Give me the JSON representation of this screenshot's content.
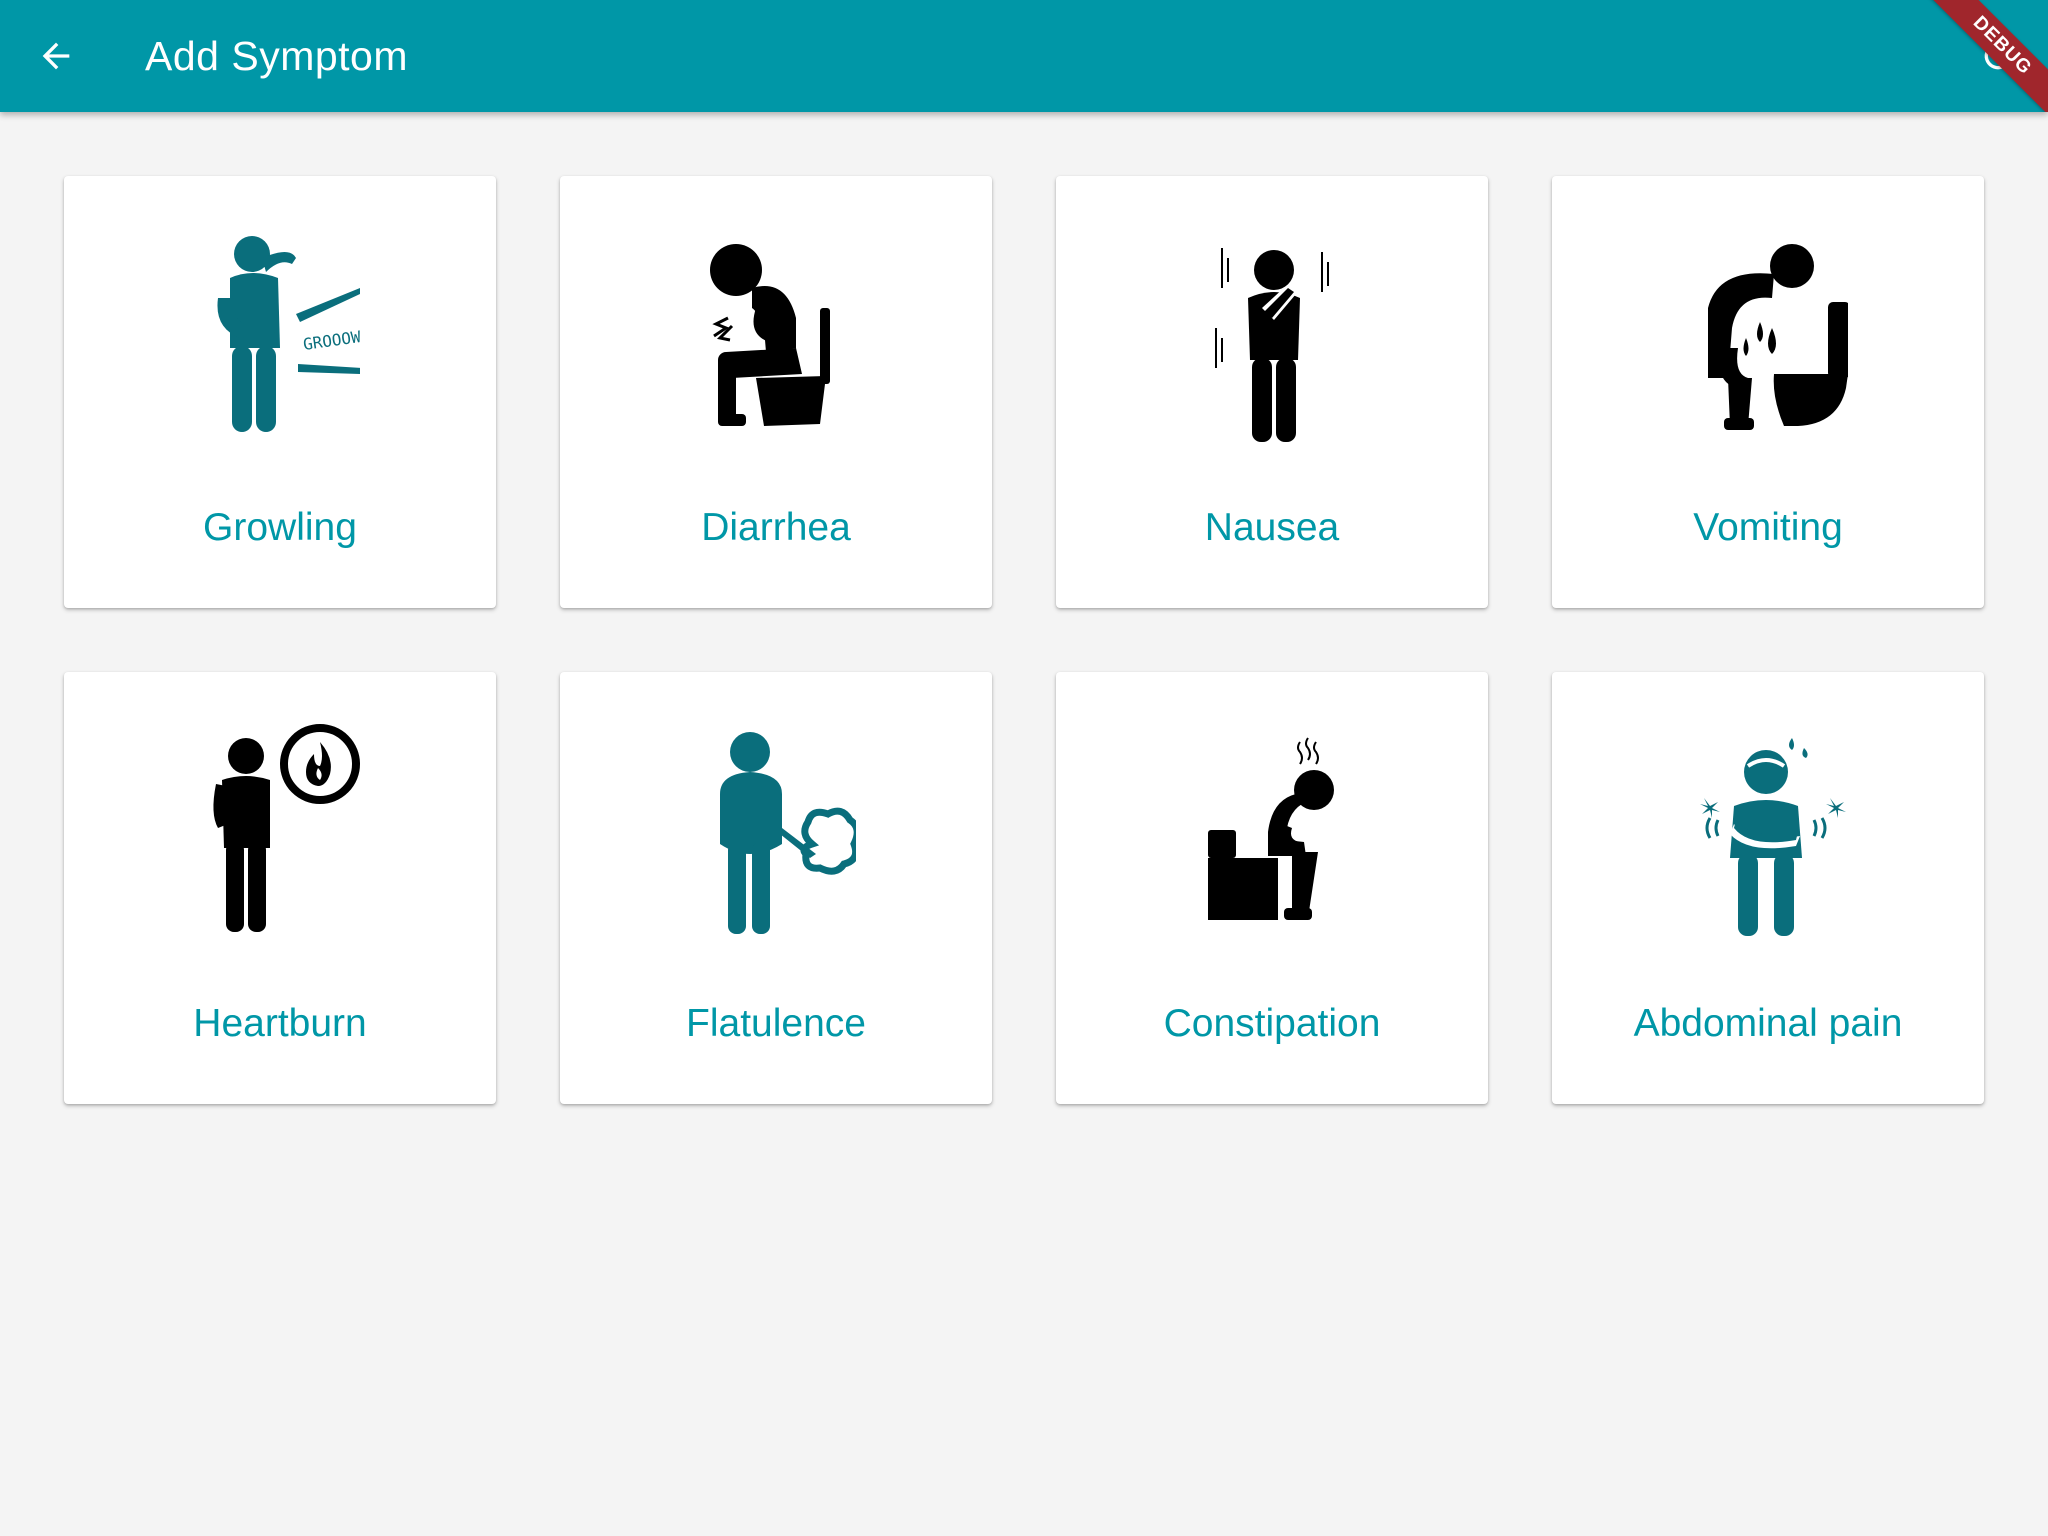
{
  "appbar": {
    "title": "Add Symptom",
    "back_icon": "arrow-back-icon",
    "refresh_icon": "refresh-icon",
    "debug_banner": "DEBUG",
    "color": "#0097a7"
  },
  "symptoms": [
    {
      "label": "Growling",
      "icon": "growling-icon",
      "icon_color": "#0a6e7c"
    },
    {
      "label": "Diarrhea",
      "icon": "diarrhea-icon",
      "icon_color": "#000000"
    },
    {
      "label": "Nausea",
      "icon": "nausea-icon",
      "icon_color": "#000000"
    },
    {
      "label": "Vomiting",
      "icon": "vomiting-icon",
      "icon_color": "#000000"
    },
    {
      "label": "Heartburn",
      "icon": "heartburn-icon",
      "icon_color": "#000000"
    },
    {
      "label": "Flatulence",
      "icon": "flatulence-icon",
      "icon_color": "#0a6e7c"
    },
    {
      "label": "Constipation",
      "icon": "constipation-icon",
      "icon_color": "#000000"
    },
    {
      "label": "Abdominal pain",
      "icon": "abdominal-pain-icon",
      "icon_color": "#0a6e7c"
    }
  ],
  "colors": {
    "accent": "#0097a7",
    "background": "#f4f4f4",
    "card": "#ffffff"
  }
}
